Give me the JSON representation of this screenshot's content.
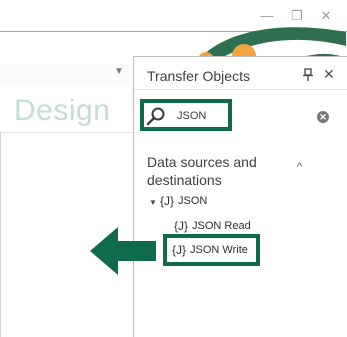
{
  "colors": {
    "accent_line": "#d9a23a",
    "highlight_border": "#0f6b4e",
    "arrow": "#0f6b4e",
    "design_text": "#c4ded5",
    "logo_green": "#2e6f4f",
    "logo_orange": "#f2a340"
  },
  "window": {
    "minimize_icon": "minimize-icon",
    "restore_icon": "restore-icon",
    "close_icon": "close-icon",
    "minimize_glyph": "—",
    "restore_glyph": "❐",
    "close_glyph": "✕"
  },
  "document": {
    "design_tab_label": "Design",
    "dropdown_glyph": "▼"
  },
  "panel": {
    "title": "Transfer Objects",
    "pin_glyph": "📌",
    "close_glyph": "✕",
    "search": {
      "value": "JSON",
      "clear_glyph": "✕"
    },
    "section_title": "Data sources and destinations",
    "section_collapse_glyph": "^",
    "tree": {
      "expand_glyph": "▼",
      "icon_glyph": "{J}",
      "group_label": "JSON",
      "items": [
        {
          "label": "JSON Read"
        },
        {
          "label": "JSON Write"
        }
      ]
    }
  }
}
